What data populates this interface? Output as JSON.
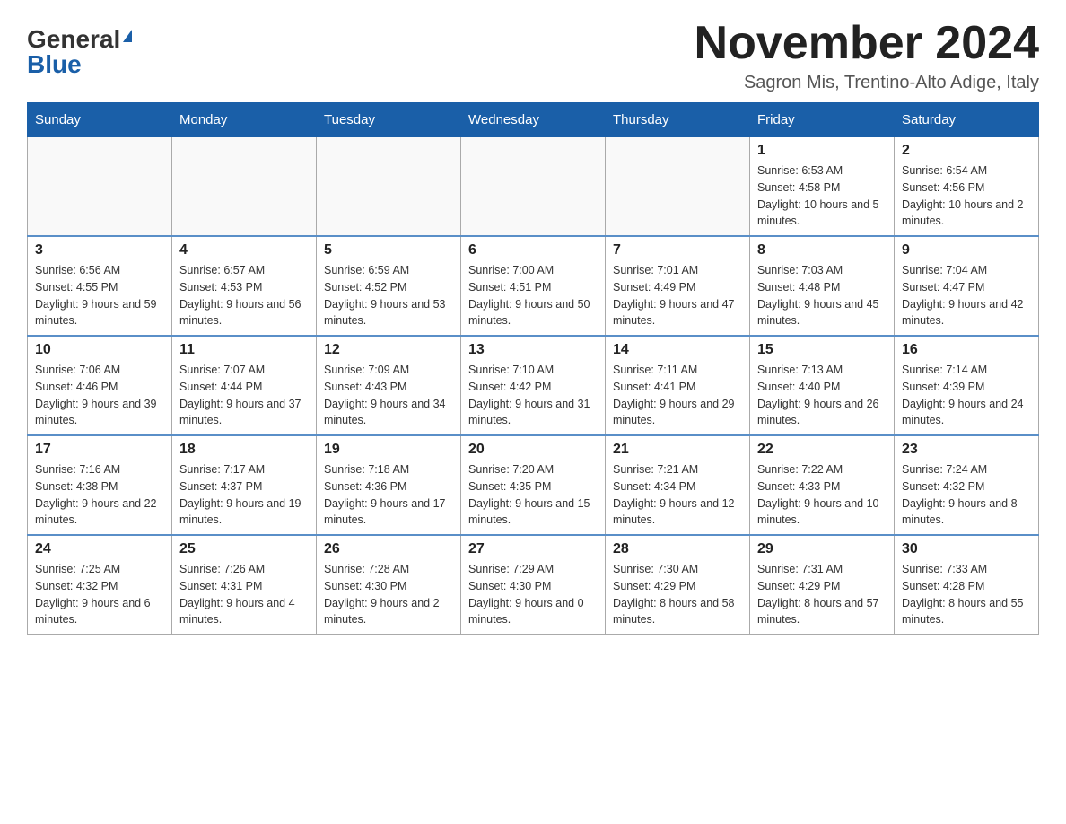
{
  "logo": {
    "general": "General",
    "blue": "Blue"
  },
  "title": "November 2024",
  "subtitle": "Sagron Mis, Trentino-Alto Adige, Italy",
  "weekdays": [
    "Sunday",
    "Monday",
    "Tuesday",
    "Wednesday",
    "Thursday",
    "Friday",
    "Saturday"
  ],
  "weeks": [
    [
      {
        "day": "",
        "info": ""
      },
      {
        "day": "",
        "info": ""
      },
      {
        "day": "",
        "info": ""
      },
      {
        "day": "",
        "info": ""
      },
      {
        "day": "",
        "info": ""
      },
      {
        "day": "1",
        "info": "Sunrise: 6:53 AM\nSunset: 4:58 PM\nDaylight: 10 hours and 5 minutes."
      },
      {
        "day": "2",
        "info": "Sunrise: 6:54 AM\nSunset: 4:56 PM\nDaylight: 10 hours and 2 minutes."
      }
    ],
    [
      {
        "day": "3",
        "info": "Sunrise: 6:56 AM\nSunset: 4:55 PM\nDaylight: 9 hours and 59 minutes."
      },
      {
        "day": "4",
        "info": "Sunrise: 6:57 AM\nSunset: 4:53 PM\nDaylight: 9 hours and 56 minutes."
      },
      {
        "day": "5",
        "info": "Sunrise: 6:59 AM\nSunset: 4:52 PM\nDaylight: 9 hours and 53 minutes."
      },
      {
        "day": "6",
        "info": "Sunrise: 7:00 AM\nSunset: 4:51 PM\nDaylight: 9 hours and 50 minutes."
      },
      {
        "day": "7",
        "info": "Sunrise: 7:01 AM\nSunset: 4:49 PM\nDaylight: 9 hours and 47 minutes."
      },
      {
        "day": "8",
        "info": "Sunrise: 7:03 AM\nSunset: 4:48 PM\nDaylight: 9 hours and 45 minutes."
      },
      {
        "day": "9",
        "info": "Sunrise: 7:04 AM\nSunset: 4:47 PM\nDaylight: 9 hours and 42 minutes."
      }
    ],
    [
      {
        "day": "10",
        "info": "Sunrise: 7:06 AM\nSunset: 4:46 PM\nDaylight: 9 hours and 39 minutes."
      },
      {
        "day": "11",
        "info": "Sunrise: 7:07 AM\nSunset: 4:44 PM\nDaylight: 9 hours and 37 minutes."
      },
      {
        "day": "12",
        "info": "Sunrise: 7:09 AM\nSunset: 4:43 PM\nDaylight: 9 hours and 34 minutes."
      },
      {
        "day": "13",
        "info": "Sunrise: 7:10 AM\nSunset: 4:42 PM\nDaylight: 9 hours and 31 minutes."
      },
      {
        "day": "14",
        "info": "Sunrise: 7:11 AM\nSunset: 4:41 PM\nDaylight: 9 hours and 29 minutes."
      },
      {
        "day": "15",
        "info": "Sunrise: 7:13 AM\nSunset: 4:40 PM\nDaylight: 9 hours and 26 minutes."
      },
      {
        "day": "16",
        "info": "Sunrise: 7:14 AM\nSunset: 4:39 PM\nDaylight: 9 hours and 24 minutes."
      }
    ],
    [
      {
        "day": "17",
        "info": "Sunrise: 7:16 AM\nSunset: 4:38 PM\nDaylight: 9 hours and 22 minutes."
      },
      {
        "day": "18",
        "info": "Sunrise: 7:17 AM\nSunset: 4:37 PM\nDaylight: 9 hours and 19 minutes."
      },
      {
        "day": "19",
        "info": "Sunrise: 7:18 AM\nSunset: 4:36 PM\nDaylight: 9 hours and 17 minutes."
      },
      {
        "day": "20",
        "info": "Sunrise: 7:20 AM\nSunset: 4:35 PM\nDaylight: 9 hours and 15 minutes."
      },
      {
        "day": "21",
        "info": "Sunrise: 7:21 AM\nSunset: 4:34 PM\nDaylight: 9 hours and 12 minutes."
      },
      {
        "day": "22",
        "info": "Sunrise: 7:22 AM\nSunset: 4:33 PM\nDaylight: 9 hours and 10 minutes."
      },
      {
        "day": "23",
        "info": "Sunrise: 7:24 AM\nSunset: 4:32 PM\nDaylight: 9 hours and 8 minutes."
      }
    ],
    [
      {
        "day": "24",
        "info": "Sunrise: 7:25 AM\nSunset: 4:32 PM\nDaylight: 9 hours and 6 minutes."
      },
      {
        "day": "25",
        "info": "Sunrise: 7:26 AM\nSunset: 4:31 PM\nDaylight: 9 hours and 4 minutes."
      },
      {
        "day": "26",
        "info": "Sunrise: 7:28 AM\nSunset: 4:30 PM\nDaylight: 9 hours and 2 minutes."
      },
      {
        "day": "27",
        "info": "Sunrise: 7:29 AM\nSunset: 4:30 PM\nDaylight: 9 hours and 0 minutes."
      },
      {
        "day": "28",
        "info": "Sunrise: 7:30 AM\nSunset: 4:29 PM\nDaylight: 8 hours and 58 minutes."
      },
      {
        "day": "29",
        "info": "Sunrise: 7:31 AM\nSunset: 4:29 PM\nDaylight: 8 hours and 57 minutes."
      },
      {
        "day": "30",
        "info": "Sunrise: 7:33 AM\nSunset: 4:28 PM\nDaylight: 8 hours and 55 minutes."
      }
    ]
  ]
}
